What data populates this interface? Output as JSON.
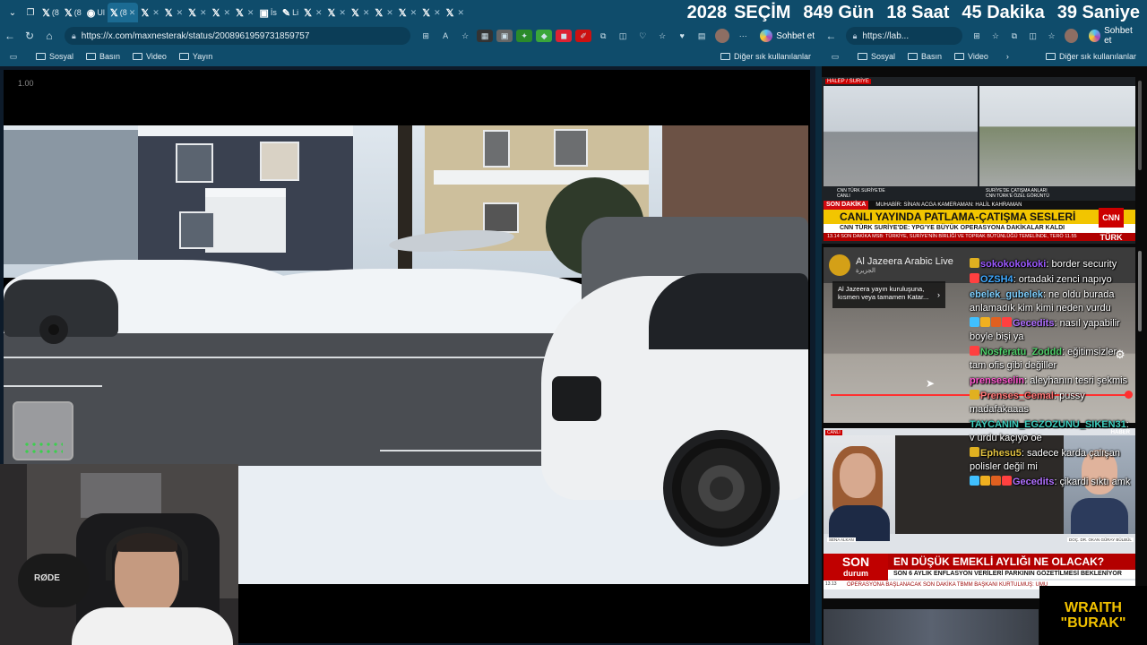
{
  "tabs": {
    "items": [
      {
        "label": "(8"
      },
      {
        "label": "(8"
      },
      {
        "label": "Ul"
      },
      {
        "label": "(8",
        "active": true
      },
      {
        "label": ""
      },
      {
        "label": ""
      },
      {
        "label": ""
      },
      {
        "label": ""
      },
      {
        "label": ""
      },
      {
        "label": "İs"
      },
      {
        "label": "Li"
      },
      {
        "label": ""
      },
      {
        "label": ""
      },
      {
        "label": ""
      },
      {
        "label": ""
      },
      {
        "label": ""
      },
      {
        "label": ""
      },
      {
        "label": ""
      },
      {
        "label": ""
      }
    ]
  },
  "countdown": {
    "year_label": "2028",
    "election_label": "SEÇİM",
    "days": "849 Gün",
    "hours": "18 Saat",
    "minutes": "45 Dakika",
    "seconds": "39 Saniye"
  },
  "left_browser": {
    "url": "https://x.com/maxnesterak/status/2008961959731859757",
    "chat_label": "Sohbet et",
    "bookmarks": [
      "Sosyal",
      "Basın",
      "Video",
      "Yayın"
    ],
    "other_bookmarks": "Diğer sık kullanılanlar",
    "playback_speed": "1.00"
  },
  "right_browser": {
    "url": "https://lab...",
    "chat_label": "Sohbet et",
    "bookmarks": [
      "Sosyal",
      "Basın",
      "Video"
    ],
    "other_bookmarks": "Diğer sık kullanılanlar"
  },
  "webcam": {
    "mic_brand": "RØDE"
  },
  "cnn": {
    "location_tag": "HALEP / SURİYE",
    "cap_left": "CNN TÜRK SURİYE'DE",
    "cap_left2": "CANLI",
    "cap_right": "SURİYE'DE ÇATIŞMA ANLARI",
    "cap_right2": "CNN TÜRK'E ÖZEL GÖRÜNTÜ",
    "son_dakika": "SON DAKİKA",
    "reporter": "MUHABİR: SİNAN ACGA KAMERAMAN: HALİL KAHRAMAN",
    "headline": "CANLI YAYINDA PATLAMA-ÇATIŞMA SESLERİ",
    "subheadline": "CNN TÜRK SURİYE'DE: YPG'YE BÜYÜK OPERASYONA DAKİKALAR KALDI",
    "ticker": "13.14 SON DAKİKA  MSB: TÜRKİYE, SURİYE'NİN BİRLİĞİ VE TOPRAK BÜTÜNLÜĞÜ TEMELİNDE, TERÖ  11.55",
    "logo": "CNN TÜRK",
    "live_tag": "CANLI"
  },
  "aljazeera": {
    "channel": "Al Jazeera Arabic Live",
    "channel_ar": "الجزيرة",
    "card_text": "Al Jazeera yayın kuruluşuna, kısmen veya tamamen Katar...",
    "card_arrow": "›"
  },
  "news2": {
    "live_tag": "CANLI",
    "haber_tag": "HABER",
    "anchor_name": "SENA ALKAN",
    "guest_name": "DOÇ. DR. OKAN GÜRAY BÜLBÜL",
    "son": "SON",
    "durum": "durum",
    "headline": "EN DÜŞÜK EMEKLİ AYLIĞI NE OLACAK?",
    "subheadline": "SON 6 AYLIK ENFLASYON VERİLERİ PARKININ GÖZETİLMESİ BEKLENİYOR",
    "ticker": "OPERASYONA BAŞLANACAK    SON DAKİKA    TBMM BAŞKANI KURTULMUŞ: UMU",
    "time": "13.13"
  },
  "overlay": {
    "line1": "WRAITH",
    "line2": "\"BURAK\""
  },
  "chat": [
    {
      "user": "sokokokokoki",
      "sep": ":",
      "text": " border security",
      "color": "#9b59ff",
      "emotes": [
        "#e0b020"
      ]
    },
    {
      "user": "OZSH4",
      "sep": ":",
      "text": " ortadaki zenci napıyo",
      "color": "#3fa9ff",
      "emotes": [
        "#ff4040"
      ]
    },
    {
      "user": "ebelek_gubelek",
      "sep": ":",
      "text": " ne oldu burada anlamadık kim kimi neden vurdu",
      "color": "#7fd0ff",
      "emotes": []
    },
    {
      "user": "Gecedits",
      "sep": ":",
      "text": " nasıl yapabilir böyle bişi ya",
      "color": "#b070ff",
      "emotes": [
        "#40c0ff",
        "#f0b020",
        "#e06020",
        "#ff4040"
      ]
    },
    {
      "user": "Nosferatu_Zoddd",
      "sep": ":",
      "text": " eğitimsizler tam ofis gibi değiller",
      "color": "#4fd06a",
      "emotes": [
        "#ff4040"
      ]
    },
    {
      "user": "prenseselin",
      "sep": ":",
      "text": " aleyhanın tesri şekmis",
      "color": "#ff5ad0",
      "emotes": []
    },
    {
      "user": "Prenses_Cemal",
      "sep": ":",
      "text": " pussy madafakaaas",
      "color": "#ff7a7a",
      "emotes": [
        "#e0b020"
      ]
    },
    {
      "user": "TAYCANIN_EGZOZUNU_SIKEN31",
      "sep": ":",
      "text": " v urdu kaçıyo oe",
      "color": "#3fd0c0",
      "emotes": []
    },
    {
      "user": "Ephesu5",
      "sep": ":",
      "text": " sadece karda çalışan polisler değil mi",
      "color": "#e0c040",
      "emotes": [
        "#e0b020"
      ]
    },
    {
      "user": "Gecedits",
      "sep": ":",
      "text": " çikardi sıktı amk",
      "color": "#b070ff",
      "emotes": [
        "#40c0ff",
        "#f0b020",
        "#e06020",
        "#ff4040"
      ]
    }
  ]
}
